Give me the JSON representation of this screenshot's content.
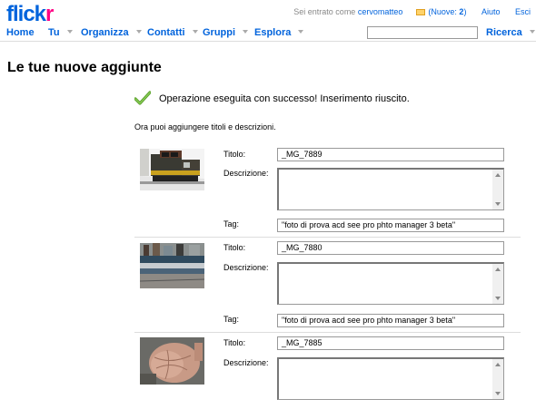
{
  "header": {
    "logo_prefix": "flick",
    "logo_suffix": "r",
    "signed_in_label": "Sei entrato come",
    "username": "cervomatteo",
    "new_mail_prefix": "(Nuove: ",
    "new_mail_count": "2",
    "new_mail_suffix": ")",
    "help_link": "Aiuto",
    "logout_link": "Esci",
    "colors": {
      "brand_blue": "#0063dc",
      "brand_pink": "#ff0084"
    }
  },
  "nav": {
    "items": [
      {
        "label": "Home",
        "has_menu": false
      },
      {
        "label": "Tu",
        "has_menu": true
      },
      {
        "label": "Organizza",
        "has_menu": true
      },
      {
        "label": "Contatti",
        "has_menu": true
      },
      {
        "label": "Gruppi",
        "has_menu": true
      },
      {
        "label": "Esplora",
        "has_menu": true
      }
    ],
    "search_value": "",
    "search_button": "Ricerca"
  },
  "main": {
    "title": "Le tue nuove aggiunte",
    "success_message": "Operazione eseguita con successo! Inserimento riuscito.",
    "intro": "Ora puoi aggiungere titoli e descrizioni.",
    "labels": {
      "title": "Titolo:",
      "description": "Descrizione:",
      "tags": "Tag:"
    },
    "photos": [
      {
        "thumbnail": "train-locomotive-photo",
        "title": "_MG_7889",
        "description": "",
        "tags": "\"foto di prova acd see pro phto manager 3 beta\""
      },
      {
        "thumbnail": "train-station-photo",
        "title": "_MG_7880",
        "description": "",
        "tags": "\"foto di prova acd see pro phto manager 3 beta\""
      },
      {
        "thumbnail": "hand-palm-photo",
        "title": "_MG_7885",
        "description": "",
        "tags": ""
      }
    ]
  }
}
